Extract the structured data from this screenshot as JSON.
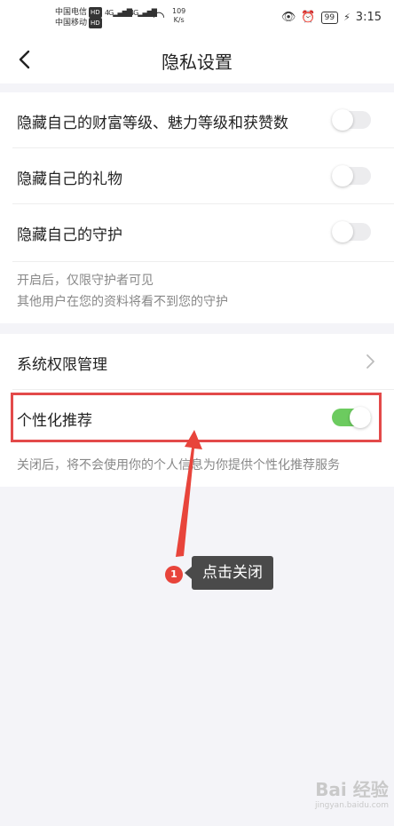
{
  "status": {
    "carrier1": "中国电信",
    "carrier2": "中国移动",
    "hd": "HD",
    "network1": "4G",
    "network2": "4G",
    "speed_value": "109",
    "speed_unit": "K/s",
    "battery": "99",
    "time": "3:15"
  },
  "nav": {
    "title": "隐私设置"
  },
  "settings": {
    "hide_wealth": {
      "label": "隐藏自己的财富等级、魅力等级和获赞数",
      "on": false
    },
    "hide_gifts": {
      "label": "隐藏自己的礼物",
      "on": false
    },
    "hide_guard": {
      "label": "隐藏自己的守护",
      "on": false
    },
    "guard_note_line1": "开启后，仅限守护者可见",
    "guard_note_line2": "其他用户在您的资料将看不到您的守护",
    "system_permissions": {
      "label": "系统权限管理"
    },
    "personalized": {
      "label": "个性化推荐",
      "on": true
    },
    "personalized_note": "关闭后，将不会使用你的个人信息为你提供个性化推荐服务"
  },
  "annotation": {
    "step": "1",
    "text": "点击关闭",
    "highlight_color": "#e34a4a"
  },
  "watermark": {
    "line1": "Bai 经验",
    "line2": "jingyan.baidu.com"
  },
  "colors": {
    "toggle_on": "#6ccb5f",
    "toggle_off": "#ececee"
  }
}
